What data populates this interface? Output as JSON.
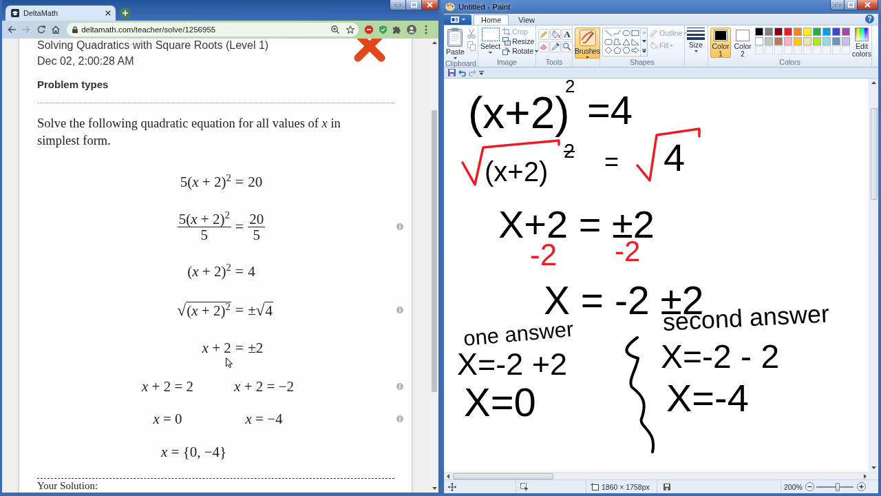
{
  "browser": {
    "tabs": [
      {
        "title": "DeltaMath",
        "selected": true
      }
    ],
    "nav": [
      {
        "kind": "back",
        "disabled": false
      },
      {
        "kind": "forward",
        "disabled": true
      },
      {
        "kind": "reload",
        "disabled": false
      },
      {
        "kind": "home",
        "disabled": false
      }
    ],
    "url": "deltamath.com/teacher/solve/1256955"
  },
  "problem": {
    "title": "Solving Quadratics with Square Roots (Level 1)",
    "date": "Dec 02, 2:00:28 AM",
    "correct": false,
    "section": "Problem types",
    "prompt": "Solve the following quadratic equation for all values of *x* in simplest form.",
    "steps": [
      {
        "kind": "aligned",
        "info": false,
        "lhs": [
          {
            "kind": "text",
            "text": "5(*x* + 2)$^{2}$"
          }
        ],
        "rel": "=",
        "rhs": [
          {
            "kind": "text",
            "text": "20"
          }
        ]
      },
      {
        "kind": "aligned",
        "info": true,
        "lhs": [
          {
            "kind": "frac",
            "num": "5(*x* + 2)$^{2}$",
            "den": "5"
          }
        ],
        "rel": "=",
        "rhs": [
          {
            "kind": "frac",
            "num": "20",
            "den": "5"
          }
        ]
      },
      {
        "kind": "aligned",
        "info": false,
        "lhs": [
          {
            "kind": "text",
            "text": "(*x* + 2)$^{2}$"
          }
        ],
        "rel": "=",
        "rhs": [
          {
            "kind": "text",
            "text": "4"
          }
        ]
      },
      {
        "kind": "aligned",
        "info": true,
        "lhs": [
          {
            "kind": "root",
            "sign": "√",
            "radicand": "(*x* + 2)$^{2}$"
          }
        ],
        "rel": "=",
        "rhs": [
          {
            "kind": "text",
            "text": "±"
          },
          {
            "kind": "root",
            "sign": "√",
            "radicand": "4"
          }
        ]
      },
      {
        "kind": "aligned",
        "info": false,
        "lhs": [
          {
            "kind": "text",
            "text": "*x* + 2"
          }
        ],
        "rel": "=",
        "rhs": [
          {
            "kind": "text",
            "text": "±2"
          }
        ]
      },
      {
        "kind": "pair",
        "info": true,
        "items": [
          "*x* + 2 = 2",
          "*x* + 2 = −2"
        ]
      },
      {
        "kind": "pair",
        "info": true,
        "items": [
          "*x* = 0",
          "*x* = −4"
        ]
      },
      {
        "kind": "result",
        "info": false,
        "text": "*x* = {0, −4}"
      }
    ],
    "footer": "Your Solution:"
  },
  "paint": {
    "title": "Untitled - Paint",
    "tabs": [
      {
        "label": "Home",
        "selected": true
      },
      {
        "label": "View",
        "selected": false
      }
    ],
    "help": "?",
    "clipboard": {
      "label": "Clipboard",
      "paste": "Paste",
      "actions": [
        {
          "kind": "cut",
          "disabled": true
        },
        {
          "kind": "copy",
          "disabled": true
        }
      ]
    },
    "image": {
      "label": "Image",
      "select": "Select",
      "actions": [
        {
          "kind": "crop",
          "label": "Crop",
          "disabled": true
        },
        {
          "kind": "resize",
          "label": "Resize",
          "disabled": false
        },
        {
          "kind": "rotate",
          "label": "Rotate",
          "disabled": false
        }
      ]
    },
    "tools": {
      "label": "Tools",
      "text_tool": "A"
    },
    "brushes": {
      "label": "Brushes",
      "selected": true
    },
    "shapes": {
      "label": "Shapes",
      "options": [
        {
          "kind": "outline",
          "label": "Outline",
          "disabled": true
        },
        {
          "kind": "fill",
          "label": "Fill",
          "disabled": true
        }
      ]
    },
    "size": {
      "label": "Size"
    },
    "colors": {
      "label": "Colors",
      "slots": [
        {
          "label": "Color 1",
          "color": "#000000",
          "selected": true
        },
        {
          "label": "Color 2",
          "color": "#ffffff",
          "selected": false
        }
      ],
      "palette": [
        {
          "color": "#000000"
        },
        {
          "color": "#7f7f7f"
        },
        {
          "color": "#880015"
        },
        {
          "color": "#ed1c24"
        },
        {
          "color": "#ff7f27"
        },
        {
          "color": "#fff200"
        },
        {
          "color": "#22b14c"
        },
        {
          "color": "#00a2e8"
        },
        {
          "color": "#3f48cc"
        },
        {
          "color": "#a349a4"
        },
        {
          "color": "#ffffff"
        },
        {
          "color": "#c3c3c3"
        },
        {
          "color": "#b97a57"
        },
        {
          "color": "#ffaec9"
        },
        {
          "color": "#ffc90e"
        },
        {
          "color": "#efe4b0"
        },
        {
          "color": "#b5e61d"
        },
        {
          "color": "#99d9ea"
        },
        {
          "color": "#7092be"
        },
        {
          "color": "#c8bfe7"
        }
      ],
      "edit": "Edit colors"
    },
    "quick_access": [
      {
        "kind": "save",
        "disabled": false
      },
      {
        "kind": "undo",
        "disabled": false
      },
      {
        "kind": "redo",
        "disabled": true
      }
    ],
    "canvas": {
      "marks": [
        {
          "kind": "text",
          "text": "(x+2)",
          "color": "#000000"
        },
        {
          "kind": "text",
          "text": "2",
          "color": "#000000"
        },
        {
          "kind": "text",
          "text": "=4",
          "color": "#000000"
        },
        {
          "kind": "radical",
          "color": "#ed1c24"
        },
        {
          "kind": "text",
          "text": "(x+2)",
          "color": "#000000"
        },
        {
          "kind": "struck",
          "text": "2",
          "color": "#000000"
        },
        {
          "kind": "text",
          "text": "=",
          "color": "#000000"
        },
        {
          "kind": "radical",
          "color": "#ed1c24"
        },
        {
          "kind": "text",
          "text": "4",
          "color": "#000000"
        },
        {
          "kind": "text",
          "text": "X+2 = ±2",
          "color": "#000000"
        },
        {
          "kind": "text",
          "text": "-2",
          "color": "#ed1c24"
        },
        {
          "kind": "text",
          "text": "-2",
          "color": "#ed1c24"
        },
        {
          "kind": "text",
          "text": "X = -2 ±2",
          "color": "#000000"
        },
        {
          "kind": "text",
          "text": "one answer",
          "color": "#000000"
        },
        {
          "kind": "text",
          "text": "second answer",
          "color": "#000000"
        },
        {
          "kind": "text",
          "text": "X=-2 +2",
          "color": "#000000"
        },
        {
          "kind": "brace",
          "color": "#000000"
        },
        {
          "kind": "text",
          "text": "X=-2 - 2",
          "color": "#000000"
        },
        {
          "kind": "text",
          "text": "X=0",
          "color": "#000000"
        },
        {
          "kind": "text",
          "text": "X=-4",
          "color": "#000000"
        }
      ]
    },
    "status": {
      "image_size": "1860 × 1758px",
      "zoom": "200%",
      "zoom_slider": {
        "level": 0.57
      }
    }
  }
}
